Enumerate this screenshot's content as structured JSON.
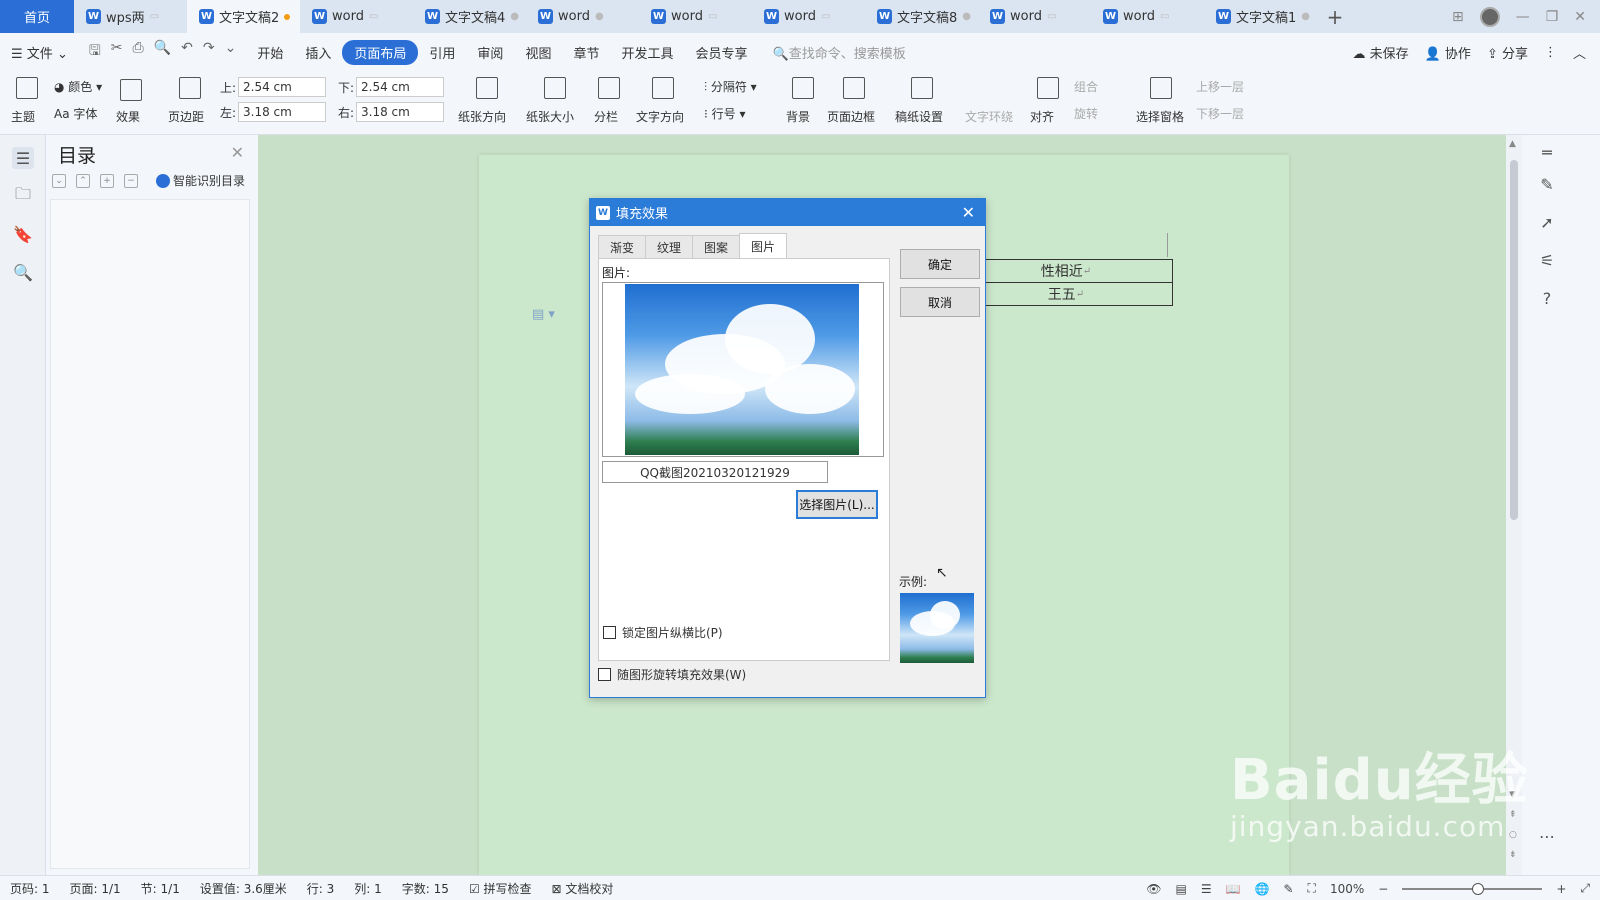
{
  "tabs": {
    "home": "首页",
    "docs": [
      {
        "label": "wps两",
        "active": false
      },
      {
        "label": "文字文稿2",
        "active": true
      },
      {
        "label": "word",
        "active": false
      },
      {
        "label": "文字文稿4",
        "active": false
      },
      {
        "label": "word",
        "active": false
      },
      {
        "label": "word",
        "active": false
      },
      {
        "label": "word",
        "active": false
      },
      {
        "label": "文字文稿8",
        "active": false
      },
      {
        "label": "word",
        "active": false
      },
      {
        "label": "word",
        "active": false
      },
      {
        "label": "文字文稿1",
        "active": false
      }
    ],
    "new_tab": "+"
  },
  "menu": {
    "file": "文件",
    "items": [
      "开始",
      "插入",
      "页面布局",
      "引用",
      "审阅",
      "视图",
      "章节",
      "开发工具",
      "会员专享"
    ],
    "active": "页面布局",
    "search": "查找命令、搜索模板",
    "unsaved": "未保存",
    "collab": "协作",
    "share": "分享"
  },
  "ribbon": {
    "theme": "主题",
    "color": "颜色",
    "font": "Aa 字体",
    "effect": "效果",
    "margins": "页边距",
    "top_label": "上:",
    "top_value": "2.54 cm",
    "bottom_label": "下:",
    "bottom_value": "2.54 cm",
    "left_label": "左:",
    "left_value": "3.18 cm",
    "right_label": "右:",
    "right_value": "3.18 cm",
    "orientation": "纸张方向",
    "size": "纸张大小",
    "columns": "分栏",
    "text_dir": "文字方向",
    "breaks": "分隔符",
    "line_num": "行号",
    "background": "背景",
    "page_border": "页面边框",
    "manuscript": "稿纸设置",
    "wrap": "文字环绕",
    "align": "对齐",
    "group": "组合",
    "rotate": "旋转",
    "selection_pane": "选择窗格",
    "bring_forward": "上移一层",
    "send_backward": "下移一层"
  },
  "nav": {
    "title": "目录",
    "smart_toc": "智能识别目录"
  },
  "document": {
    "cell1": "性相近",
    "cell2": "王五"
  },
  "dialog": {
    "title": "填充效果",
    "tabs": [
      "渐变",
      "纹理",
      "图案",
      "图片"
    ],
    "active_tab": "图片",
    "picture_label": "图片:",
    "filename": "QQ截图20210320121929",
    "select_button": "选择图片(L)...",
    "lock_ratio": "锁定图片纵横比(P)",
    "rotate_with_shape": "随图形旋转填充效果(W)",
    "sample_label": "示例:",
    "ok": "确定",
    "cancel": "取消"
  },
  "status": {
    "page_no": "页码: 1",
    "pages": "页面: 1/1",
    "section": "节: 1/1",
    "setting": "设置值: 3.6厘米",
    "row": "行: 3",
    "col": "列: 1",
    "words": "字数: 15",
    "spell": "拼写检查",
    "proof": "文档校对",
    "zoom": "100%"
  },
  "watermark": {
    "line1": "Baidu经验",
    "line2": "jingyan.baidu.com"
  },
  "colors": {
    "accent": "#2b6fd6",
    "doc_bg": "#c7e0c7",
    "dialog_title": "#2b7bd8"
  }
}
